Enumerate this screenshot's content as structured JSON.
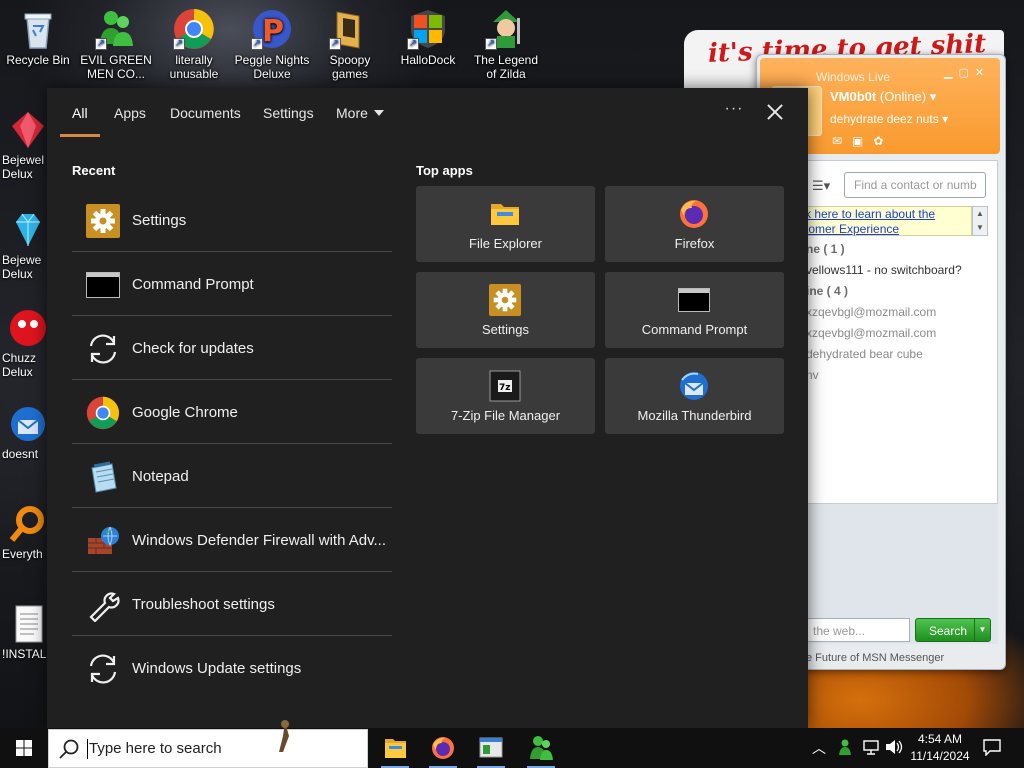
{
  "desktop": {
    "top_icons": [
      {
        "label": "Recycle Bin"
      },
      {
        "label": "EVIL GREEN MEN CO..."
      },
      {
        "label": "literally unusable"
      },
      {
        "label": "Peggle Nights Deluxe"
      },
      {
        "label": "Spoopy games"
      },
      {
        "label": "HalloDock"
      },
      {
        "label": "The Legend of Zilda"
      }
    ],
    "left_icons": [
      {
        "label_1": "Bejewel",
        "label_2": "Delux"
      },
      {
        "label_1": "Bejewe",
        "label_2": "Delux"
      },
      {
        "label_1": "Chuzz",
        "label_2": "Delux"
      },
      {
        "label_1": "doesnt",
        "label_2": ""
      },
      {
        "label_1": "Everyth",
        "label_2": ""
      },
      {
        "label_1": "!INSTALL",
        "label_2": ""
      }
    ],
    "wallpaper_text": "it's time to get shit"
  },
  "messenger": {
    "title": "Windows Live",
    "user_name": "VM0b0t",
    "status": "(Online)",
    "personal_message": "dehydrate deez nuts",
    "search_placeholder": "Find a contact or numb",
    "info_line_1": "k here to learn about the",
    "info_line_2": "tomer Experience",
    "rows": [
      {
        "text": "ne ( 1 )",
        "kind": "grp"
      },
      {
        "text": "vellows111 - no switchboard?",
        "kind": "contact"
      },
      {
        "text": "ine ( 4 )",
        "kind": "grp"
      },
      {
        "text": "xzqevbgl@mozmail.com",
        "kind": "off"
      },
      {
        "text": "xzqevbgl@mozmail.com",
        "kind": "off"
      },
      {
        "text": "dehydrated bear cube",
        "kind": "off"
      },
      {
        "text": "nv",
        "kind": "off"
      }
    ],
    "web_placeholder": "the web...",
    "search_button": "Search",
    "footer": "e Future of MSN Messenger"
  },
  "flyout": {
    "tabs": [
      {
        "label": "All",
        "active": true
      },
      {
        "label": "Apps",
        "active": false
      },
      {
        "label": "Documents",
        "active": false
      },
      {
        "label": "Settings",
        "active": false
      },
      {
        "label": "More",
        "active": false
      }
    ],
    "ellipsis": "···",
    "recent_heading": "Recent",
    "recent": [
      {
        "label": "Settings",
        "icon": "gear-icon"
      },
      {
        "label": "Command Prompt",
        "icon": "cmd-icon"
      },
      {
        "label": "Check for updates",
        "icon": "refresh-icon"
      },
      {
        "label": "Google Chrome",
        "icon": "chrome-icon"
      },
      {
        "label": "Notepad",
        "icon": "notepad-icon"
      },
      {
        "label": "Windows Defender Firewall with Adv...",
        "icon": "firewall-icon"
      },
      {
        "label": "Troubleshoot settings",
        "icon": "wrench-icon"
      },
      {
        "label": "Windows Update settings",
        "icon": "refresh-icon"
      }
    ],
    "top_apps_heading": "Top apps",
    "top_apps": [
      {
        "label": "File Explorer",
        "icon": "folder-icon"
      },
      {
        "label": "Firefox",
        "icon": "firefox-icon"
      },
      {
        "label": "Settings",
        "icon": "gear-icon"
      },
      {
        "label": "Command Prompt",
        "icon": "cmd-icon"
      },
      {
        "label": "7-Zip File Manager",
        "icon": "7zip-icon"
      },
      {
        "label": "Mozilla Thunderbird",
        "icon": "thunderbird-icon"
      }
    ]
  },
  "taskbar": {
    "search_placeholder": "Type here to search",
    "time": "4:54 AM",
    "date": "11/14/2024",
    "accent": "#d68a3a"
  }
}
